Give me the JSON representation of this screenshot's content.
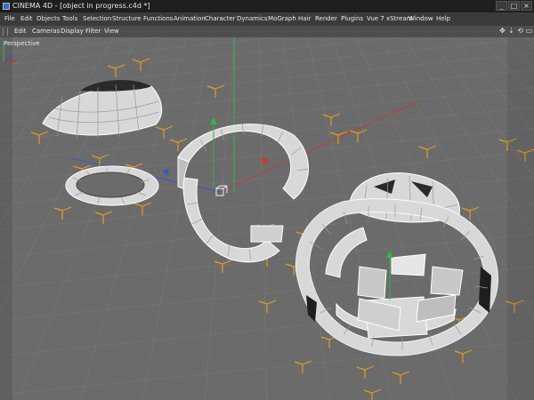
{
  "window": {
    "title": "CINEMA 4D - [object in progress.c4d *]",
    "icons": {
      "app": "cinema4d-icon",
      "minimize": "minimize-icon",
      "maximize": "maximize-icon",
      "close": "close-icon"
    }
  },
  "menu": {
    "items": [
      "File",
      "Edit",
      "Objects",
      "Tools",
      "Selection",
      "Structure",
      "Functions",
      "Animation",
      "Character",
      "Dynamics",
      "MoGraph",
      "Hair",
      "Render",
      "Plugins",
      "Vue 7 xStream",
      "Window",
      "Help"
    ]
  },
  "viewport_menu": {
    "items": [
      "Edit",
      "Cameras",
      "Display",
      "Filter",
      "View"
    ],
    "nav_icons": [
      "move-view-icon",
      "dolly-view-icon",
      "rotate-view-icon",
      "toggle-layout-icon"
    ]
  },
  "viewport": {
    "label": "Perspective",
    "colors": {
      "background": "#6b6b6b",
      "grid": "#7a7a7a",
      "mesh_face": "#d8d8d8",
      "mesh_edge": "#ffffff",
      "bbox": "#e39b1f",
      "axis_x": "#c43a3a",
      "axis_y": "#3ab14a",
      "axis_z": "#3a55c4"
    }
  }
}
